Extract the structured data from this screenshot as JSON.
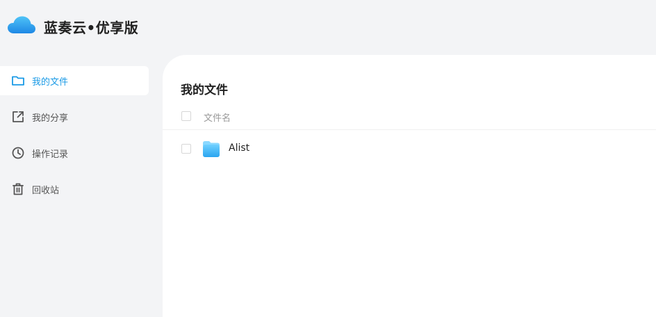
{
  "header": {
    "app_title": "蓝奏云•优享版",
    "logo_icon": "cloud-logo-icon"
  },
  "sidebar": {
    "items": [
      {
        "label": "我的文件",
        "icon": "folder-icon",
        "active": true
      },
      {
        "label": "我的分享",
        "icon": "share-icon",
        "active": false
      },
      {
        "label": "操作记录",
        "icon": "clock-icon",
        "active": false
      },
      {
        "label": "回收站",
        "icon": "trash-icon",
        "active": false
      }
    ]
  },
  "main": {
    "title": "我的文件",
    "columns": {
      "name": "文件名"
    },
    "files": [
      {
        "name": "Alist",
        "type": "folder"
      }
    ]
  },
  "colors": {
    "accent": "#1a9ae6",
    "background": "#f3f4f6",
    "panel": "#ffffff",
    "text_primary": "#222222",
    "text_secondary": "#555555"
  }
}
